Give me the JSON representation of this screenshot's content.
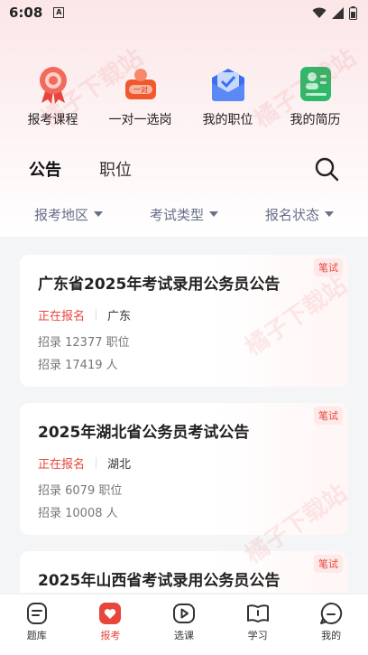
{
  "status_bar": {
    "time": "6:08",
    "indicator": "A"
  },
  "quick_actions": [
    {
      "label": "报考课程",
      "icon": "ribbon-badge-icon"
    },
    {
      "label": "一对一选岗",
      "icon": "one-on-one-icon",
      "badge": "一对"
    },
    {
      "label": "我的职位",
      "icon": "job-check-icon"
    },
    {
      "label": "我的简历",
      "icon": "resume-icon"
    }
  ],
  "tabs": [
    {
      "label": "公告",
      "active": true
    },
    {
      "label": "职位",
      "active": false
    }
  ],
  "filters": [
    {
      "label": "报考地区"
    },
    {
      "label": "考试类型"
    },
    {
      "label": "报名状态"
    }
  ],
  "cards": [
    {
      "tag": "笔试",
      "title": "广东省2025年考试录用公务员公告",
      "status": "正在报名",
      "region": "广东",
      "positions": "招录 12377 职位",
      "people": "招录 17419 人"
    },
    {
      "tag": "笔试",
      "title": "2025年湖北省公务员考试公告",
      "status": "正在报名",
      "region": "湖北",
      "positions": "招录 6079 职位",
      "people": "招录 10008 人"
    },
    {
      "tag": "笔试",
      "title": "2025年山西省考试录用公务员公告",
      "status": "",
      "region": "",
      "positions": "",
      "people": ""
    }
  ],
  "nav": [
    {
      "label": "题库",
      "active": false
    },
    {
      "label": "报考",
      "active": true
    },
    {
      "label": "选课",
      "active": false
    },
    {
      "label": "学习",
      "active": false
    },
    {
      "label": "我的",
      "active": false
    }
  ],
  "watermark": "橘子下载站",
  "colors": {
    "accent": "#e8453c",
    "filter_text": "#66708a"
  }
}
